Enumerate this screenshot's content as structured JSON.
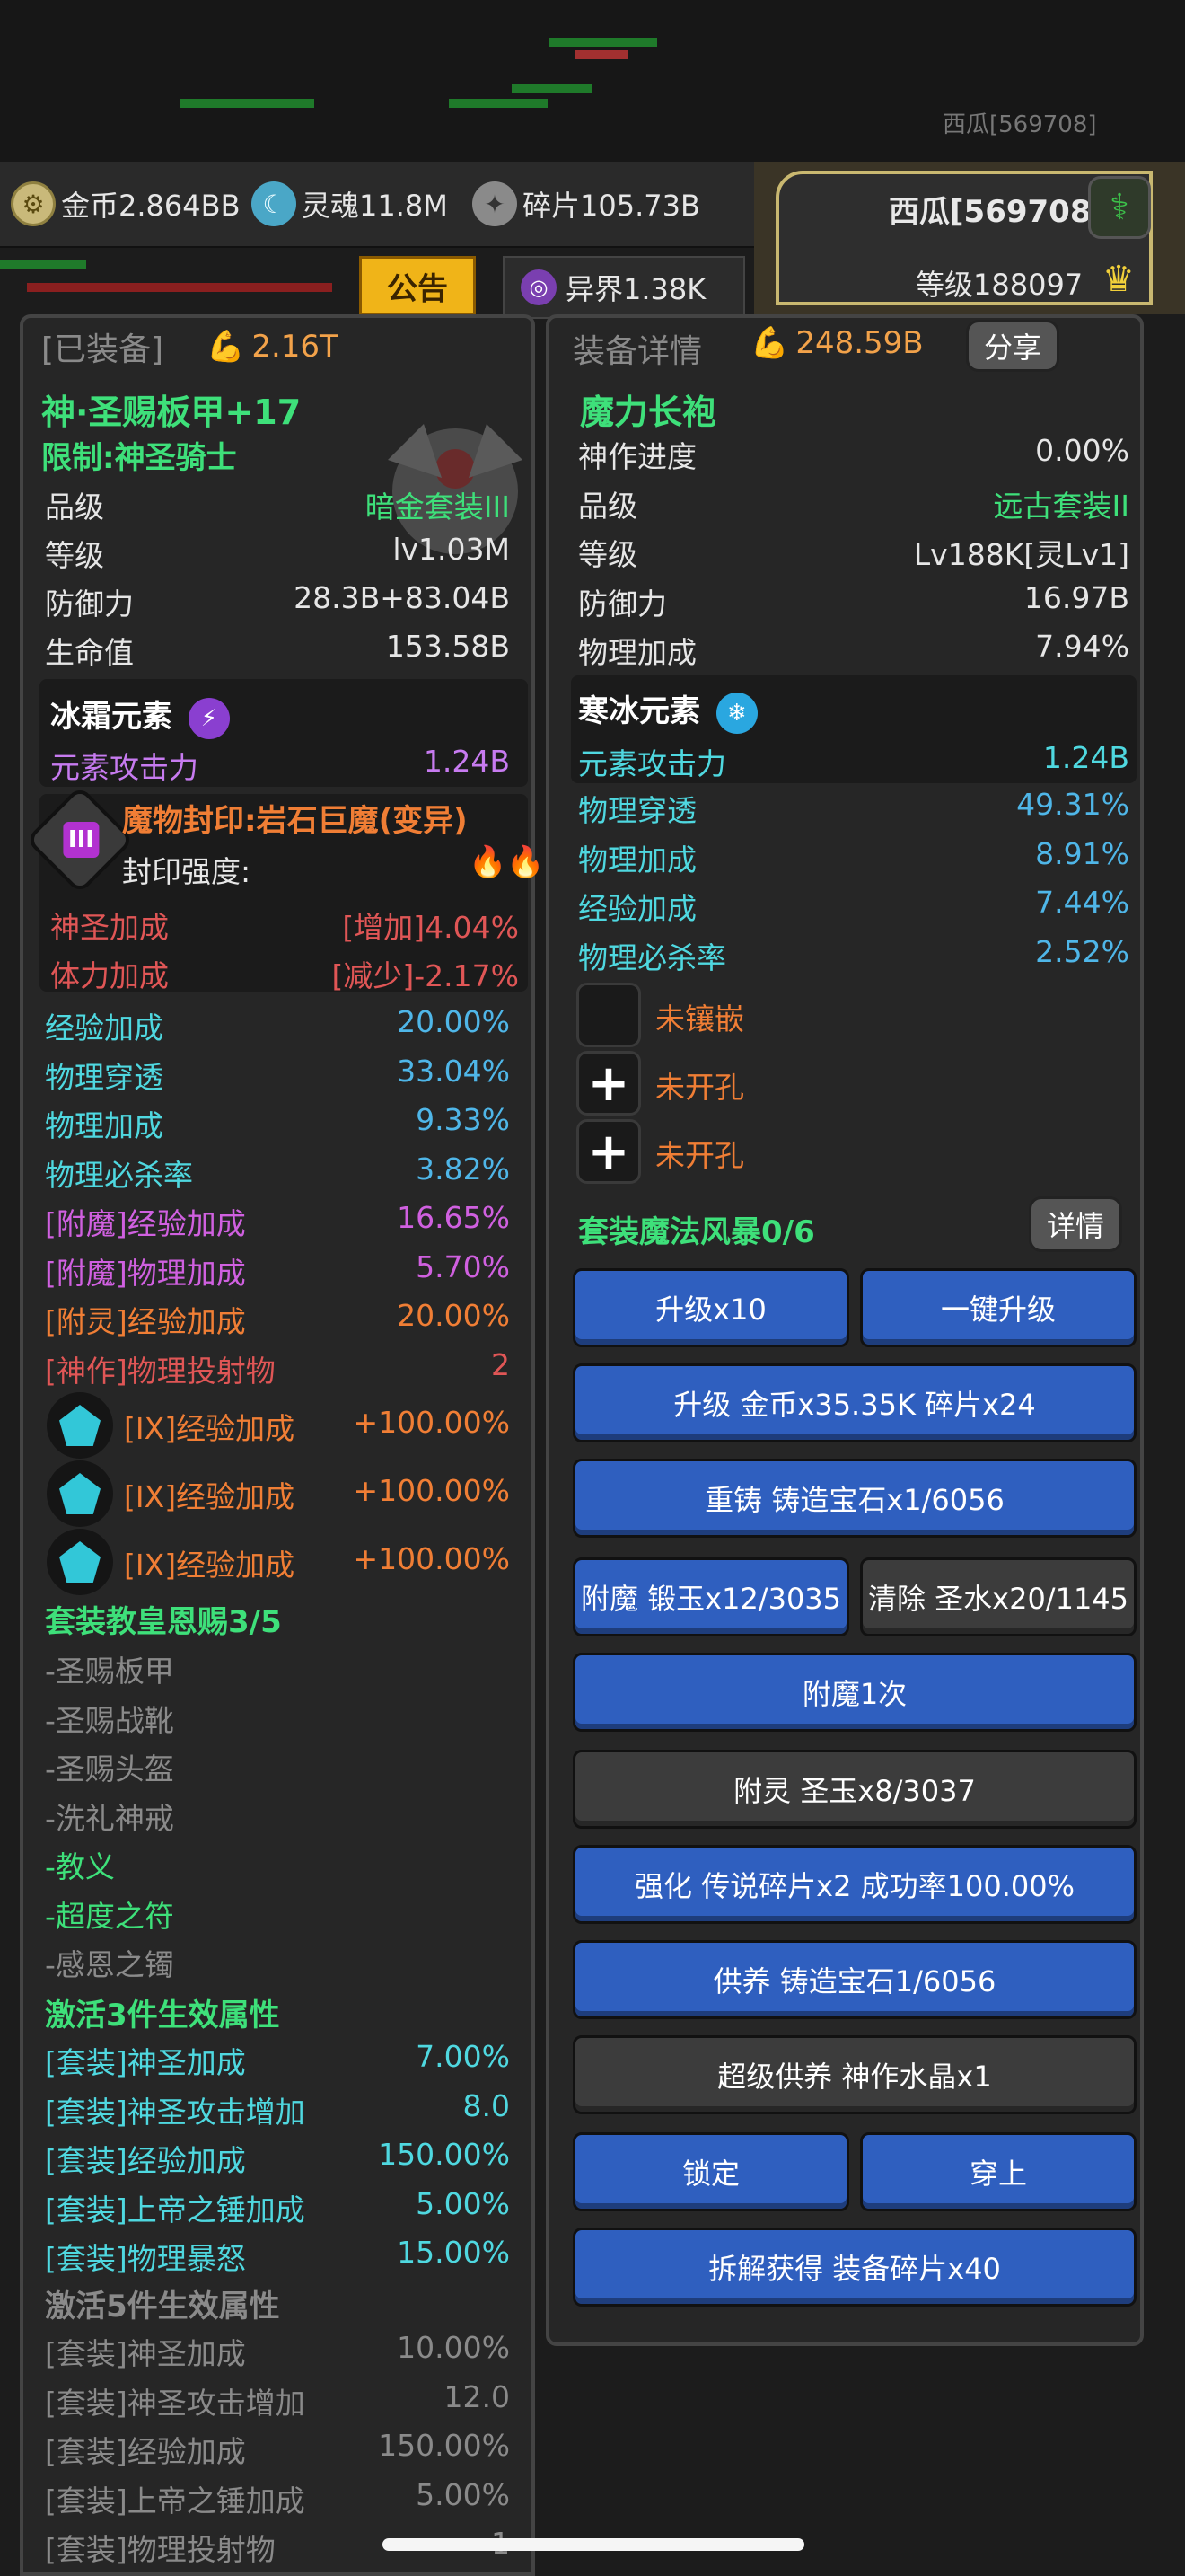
{
  "colors": {
    "green_title": "#3ee07a",
    "orange": "#f07e35",
    "cyan": "#4fb6e8",
    "purple": "#c77bf0",
    "gray": "#8a8a8a",
    "red": "#e05656",
    "blue_button": "#2f5fbf"
  },
  "background": {
    "player_label": "西瓜[569708]"
  },
  "resources": {
    "gold": "金币2.864BB",
    "gold_icon": "coin-icon",
    "soul": "灵魂11.8M",
    "soul_icon": "soul-icon",
    "fragment": "碎片105.73B",
    "fragment_icon": "fragment-icon",
    "otherworld": "异界1.38K",
    "otherworld_icon": "portal-icon",
    "notice": "公告"
  },
  "user": {
    "name": "西瓜[569708]",
    "level": "等级188097"
  },
  "equipped": {
    "header": "[已装备]",
    "power": "2.16T",
    "name": "神·圣赐板甲+17",
    "restriction": "限制:神圣骑士",
    "stats": [
      {
        "label": "品级",
        "value": "暗金套装III",
        "color": "#3ee07a"
      },
      {
        "label": "等级",
        "value": "lv1.03M",
        "color": "#e6e6e6"
      },
      {
        "label": "防御力",
        "value": "28.3B+83.04B",
        "color": "#e6e6e6"
      },
      {
        "label": "生命值",
        "value": "153.58B",
        "color": "#e6e6e6"
      }
    ],
    "element": {
      "name": "冰霜元素",
      "icon": "lightning-icon",
      "attack_label": "元素攻击力",
      "attack_value": "1.24B"
    },
    "seal": {
      "title": "魔物封印:岩石巨魔(变异)",
      "roman": "III",
      "strength_label": "封印强度:",
      "bonuses": [
        {
          "label": "神圣加成",
          "value": "[增加]4.04%"
        },
        {
          "label": "体力加成",
          "value": "[减少]-2.17%"
        }
      ]
    },
    "attributes": [
      {
        "label": "经验加成",
        "value": "20.00%",
        "lcolor": "#4fd8e0",
        "vcolor": "#4fb6e8"
      },
      {
        "label": "物理穿透",
        "value": "33.04%",
        "lcolor": "#4fd8e0",
        "vcolor": "#4fb6e8"
      },
      {
        "label": "物理加成",
        "value": "9.33%",
        "lcolor": "#4fd8e0",
        "vcolor": "#4fb6e8"
      },
      {
        "label": "物理必杀率",
        "value": "3.82%",
        "lcolor": "#4fd8e0",
        "vcolor": "#4fb6e8"
      },
      {
        "label": "[附魔]经验加成",
        "value": "16.65%",
        "lcolor": "#d060e0",
        "vcolor": "#d060e0"
      },
      {
        "label": "[附魔]物理加成",
        "value": "5.70%",
        "lcolor": "#d060e0",
        "vcolor": "#d060e0"
      },
      {
        "label": "[附灵]经验加成",
        "value": "20.00%",
        "lcolor": "#f07e35",
        "vcolor": "#f07e35"
      },
      {
        "label": "[神作]物理投射物",
        "value": "2",
        "lcolor": "#e05656",
        "vcolor": "#e05656"
      }
    ],
    "gems": [
      {
        "label": "[IX]经验加成",
        "value": "+100.00%"
      },
      {
        "label": "[IX]经验加成",
        "value": "+100.00%"
      },
      {
        "label": "[IX]经验加成",
        "value": "+100.00%"
      }
    ],
    "set": {
      "title": "套装教皇恩赐3/5",
      "pieces": [
        {
          "name": "-圣赐板甲",
          "active": false
        },
        {
          "name": "-圣赐战靴",
          "active": false
        },
        {
          "name": "-圣赐头盔",
          "active": false
        },
        {
          "name": "-洗礼神戒",
          "active": false
        },
        {
          "name": "-教义",
          "active": true
        },
        {
          "name": "-超度之符",
          "active": true
        },
        {
          "name": "-感恩之镯",
          "active": false
        }
      ],
      "tier3_title": "激活3件生效属性",
      "tier3": [
        {
          "label": "[套装]神圣加成",
          "value": "7.00%"
        },
        {
          "label": "[套装]神圣攻击增加",
          "value": "8.0"
        },
        {
          "label": "[套装]经验加成",
          "value": "150.00%"
        },
        {
          "label": "[套装]上帝之锤加成",
          "value": "5.00%"
        },
        {
          "label": "[套装]物理暴怒",
          "value": "15.00%"
        }
      ],
      "tier5_title": "激活5件生效属性",
      "tier5": [
        {
          "label": "[套装]神圣加成",
          "value": "10.00%"
        },
        {
          "label": "[套装]神圣攻击增加",
          "value": "12.0"
        },
        {
          "label": "[套装]经验加成",
          "value": "150.00%"
        },
        {
          "label": "[套装]上帝之锤加成",
          "value": "5.00%"
        },
        {
          "label": "[套装]物理投射物",
          "value": "1"
        }
      ]
    }
  },
  "detail": {
    "header": "装备详情",
    "power": "248.59B",
    "share": "分享",
    "name": "魔力长袍",
    "stats": [
      {
        "label": "神作进度",
        "value": "0.00%",
        "color": "#e6e6e6"
      },
      {
        "label": "品级",
        "value": "远古套装II",
        "color": "#3ee07a"
      },
      {
        "label": "等级",
        "value": "Lv188K[灵Lv1]",
        "color": "#e6e6e6"
      },
      {
        "label": "防御力",
        "value": "16.97B",
        "color": "#e6e6e6"
      },
      {
        "label": "物理加成",
        "value": "7.94%",
        "color": "#e6e6e6"
      }
    ],
    "element": {
      "name": "寒冰元素",
      "icon": "snowflake-icon",
      "attack_label": "元素攻击力",
      "attack_value": "1.24B"
    },
    "attributes": [
      {
        "label": "物理穿透",
        "value": "49.31%"
      },
      {
        "label": "物理加成",
        "value": "8.91%"
      },
      {
        "label": "经验加成",
        "value": "7.44%"
      },
      {
        "label": "物理必杀率",
        "value": "2.52%"
      }
    ],
    "sockets": [
      {
        "label": "未镶嵌",
        "icon": "empty-socket-icon"
      },
      {
        "label": "未开孔",
        "icon": "plus-icon"
      },
      {
        "label": "未开孔",
        "icon": "plus-icon"
      }
    ],
    "set_title": "套装魔法风暴0/6",
    "detail_button": "详情",
    "buttons": {
      "upgrade10": "升级x10",
      "upgrade_all": "一键升级",
      "upgrade_cost": "升级 金币x35.35K 碎片x24",
      "reforge": "重铸 铸造宝石x1/6056",
      "enchant": "附魔 锻玉x12/3035",
      "clear": "清除 圣水x20/1145",
      "enchant_once": "附魔1次",
      "spirit": "附灵 圣玉x8/3037",
      "strengthen": "强化 传说碎片x2 成功率100.00%",
      "nurture": "供养 铸造宝石1/6056",
      "super_nurture": "超级供养 神作水晶x1",
      "lock": "锁定",
      "wear": "穿上",
      "dismantle": "拆解获得 装备碎片x40"
    }
  }
}
